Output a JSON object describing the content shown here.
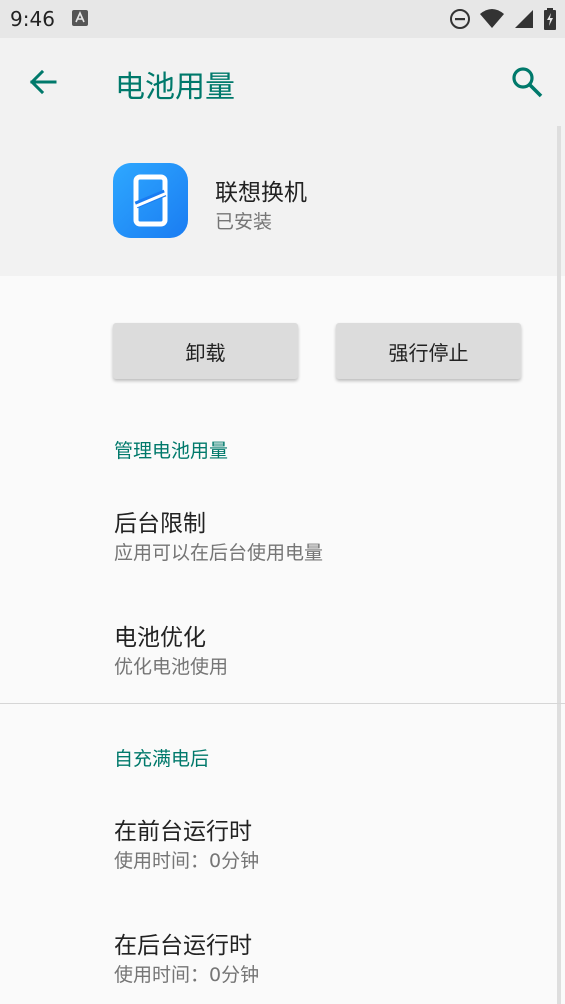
{
  "status_bar": {
    "time": "9:46",
    "notification_icon": "a-notification-icon",
    "dnd_icon": "do-not-disturb-icon",
    "wifi_icon": "wifi-icon",
    "signal_icon": "signal-icon",
    "battery_icon": "battery-icon"
  },
  "app_bar": {
    "title": "电池用量",
    "back_icon": "back-arrow-icon",
    "search_icon": "search-icon"
  },
  "app_info": {
    "name": "联想换机",
    "status": "已安装",
    "icon_colors": [
      "#2ea8ff",
      "#1a7cf2"
    ]
  },
  "buttons": {
    "uninstall": "卸载",
    "force_stop": "强行停止"
  },
  "section_manage": {
    "header": "管理电池用量",
    "items": [
      {
        "title": "后台限制",
        "subtitle": "应用可以在后台使用电量"
      },
      {
        "title": "电池优化",
        "subtitle": "优化电池使用"
      }
    ]
  },
  "section_full": {
    "header": "自充满电后",
    "items": [
      {
        "title": "在前台运行时",
        "subtitle": "使用时间：0分钟"
      },
      {
        "title": "在后台运行时",
        "subtitle": "使用时间：0分钟"
      }
    ]
  },
  "colors": {
    "accent": "#00796b",
    "background": "#fafafa",
    "header_background": "#f2f2f2"
  }
}
